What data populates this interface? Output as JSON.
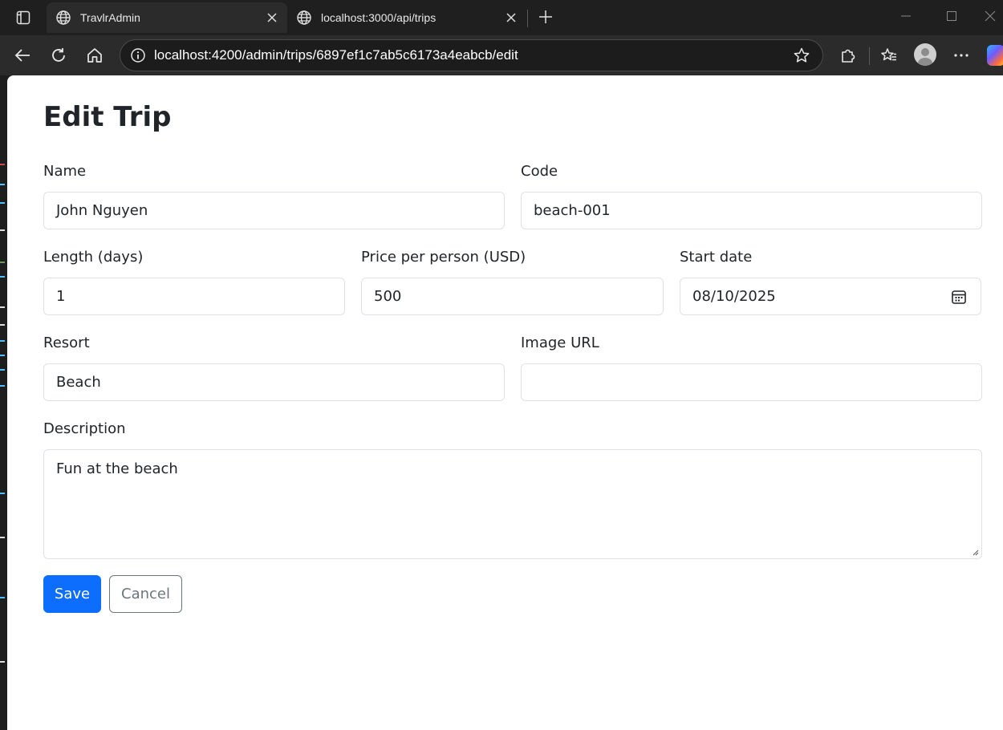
{
  "browser": {
    "tabs": [
      {
        "label": "TravlrAdmin",
        "icon": "globe-icon",
        "active": true
      },
      {
        "label": "localhost:3000/api/trips",
        "icon": "globe-icon",
        "active": false
      }
    ],
    "url": "localhost:4200/admin/trips/6897ef1c7ab5c6173a4eabcb/edit"
  },
  "page": {
    "title": "Edit Trip"
  },
  "form": {
    "name": {
      "label": "Name",
      "value": "John Nguyen"
    },
    "code": {
      "label": "Code",
      "value": "beach-001"
    },
    "length": {
      "label": "Length (days)",
      "value": "1"
    },
    "price": {
      "label": "Price per person (USD)",
      "value": "500"
    },
    "start_date": {
      "label": "Start date",
      "value": "08/10/2025"
    },
    "resort": {
      "label": "Resort",
      "value": "Beach"
    },
    "image_url": {
      "label": "Image URL",
      "value": ""
    },
    "description": {
      "label": "Description",
      "value": "Fun at the beach"
    }
  },
  "actions": {
    "save_label": "Save",
    "cancel_label": "Cancel"
  },
  "colors": {
    "primary": "#0d6efd",
    "secondary": "#6c757d",
    "text": "#212529",
    "border": "#dee2e6"
  }
}
